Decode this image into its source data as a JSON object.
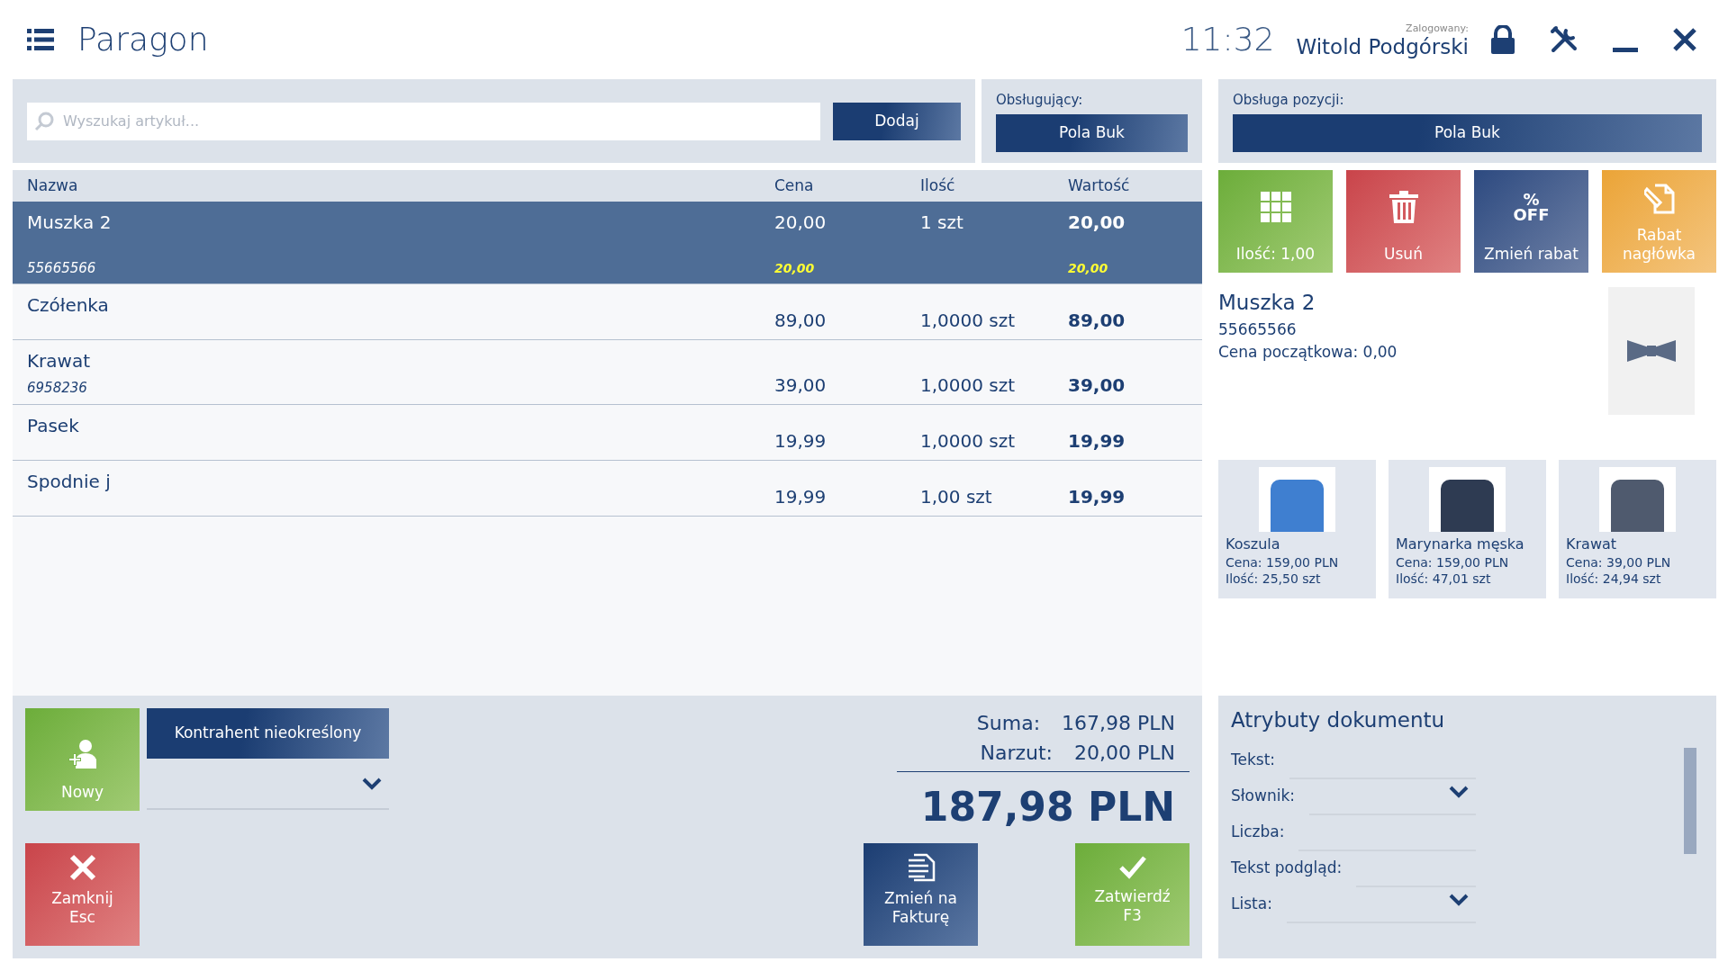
{
  "header": {
    "title": "Paragon",
    "time": "11:32",
    "user_label": "Zalogowany:",
    "user_name": "Witold Podgórski"
  },
  "search": {
    "placeholder": "Wyszukaj artykuł...",
    "button": "Dodaj"
  },
  "cashier": {
    "label": "Obsługujący:",
    "value": "Pola Buk"
  },
  "position_handling": {
    "label": "Obsługa pozycji:",
    "value": "Pola Buk"
  },
  "table": {
    "columns": [
      "Nazwa",
      "Cena",
      "Ilość",
      "Wartość"
    ],
    "rows": [
      {
        "name": "Muszka 2",
        "code": "55665566",
        "price": "20,00",
        "quantity": "1 szt",
        "value": "20,00",
        "price_note": "20,00",
        "value_note": "20,00",
        "selected": true
      },
      {
        "name": "Czółenka",
        "price": "89,00",
        "quantity": "1,0000 szt",
        "value": "89,00",
        "selected": false
      },
      {
        "name": "Krawat",
        "code": "6958236",
        "price": "39,00",
        "quantity": "1,0000 szt",
        "value": "39,00",
        "selected": false
      },
      {
        "name": "Pasek",
        "price": "19,99",
        "quantity": "1,0000 szt",
        "value": "19,99",
        "selected": false
      },
      {
        "name": "Spodnie j",
        "price": "19,99",
        "quantity": "1,00 szt",
        "value": "19,99",
        "selected": false
      }
    ]
  },
  "actions": [
    {
      "kind": "quantity",
      "label": "Ilość: 1,00"
    },
    {
      "kind": "delete",
      "label": "Usuń"
    },
    {
      "kind": "discount",
      "label": "Zmień rabat",
      "icon_text": [
        "%",
        "OFF"
      ]
    },
    {
      "kind": "header_discount",
      "label": "Rabat nagłówka"
    }
  ],
  "detail": {
    "name": "Muszka 2",
    "code": "55665566",
    "initial_price": "Cena początkowa: 0,00"
  },
  "products": [
    {
      "kind": "shirt",
      "name": "Koszula",
      "price": "Cena: 159,00 PLN",
      "quantity": "Ilość: 25,50 szt"
    },
    {
      "kind": "jacket",
      "name": "Marynarka męska",
      "price": "Cena: 159,00 PLN",
      "quantity": "Ilość: 47,01 szt"
    },
    {
      "kind": "tie",
      "name": "Krawat",
      "price": "Cena: 39,00 PLN",
      "quantity": "Ilość: 24,94 szt"
    }
  ],
  "customer": {
    "new_button": "Nowy",
    "contractor": "Kontrahent nieokreślony"
  },
  "totals": {
    "sum_label": "Suma:",
    "sum": "167,98 PLN",
    "markup_label": "Narzut:",
    "markup": "20,00 PLN",
    "total": "187,98 PLN"
  },
  "buttons": [
    {
      "kind": "close",
      "label": "Zamknij",
      "key": "Esc"
    },
    {
      "kind": "invoice",
      "label": "Zmień na",
      "key": "Fakturę"
    },
    {
      "kind": "confirm",
      "label": "Zatwierdź",
      "key": "F3"
    }
  ],
  "attributes": {
    "title": "Atrybuty dokumentu",
    "fields": [
      {
        "kind": "text",
        "label": "Tekst:"
      },
      {
        "kind": "dropdown",
        "label": "Słownik:"
      },
      {
        "kind": "text",
        "label": "Liczba:"
      },
      {
        "kind": "text",
        "label": "Tekst podgląd:"
      },
      {
        "kind": "dropdown",
        "label": "Lista:"
      }
    ]
  }
}
